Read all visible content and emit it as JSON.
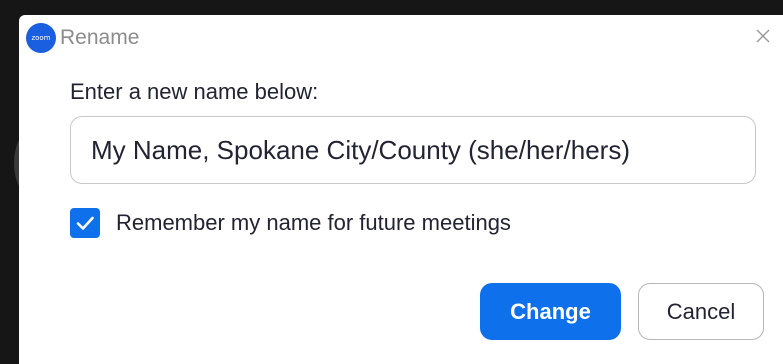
{
  "window": {
    "app_icon_text": "zoom",
    "title": "Rename",
    "close_icon": "close-icon"
  },
  "form": {
    "prompt": "Enter a new name below:",
    "name_value": "My Name, Spokane City/County (she/her/hers)",
    "remember_checked": true,
    "remember_label": "Remember my name for future meetings"
  },
  "buttons": {
    "change_label": "Change",
    "cancel_label": "Cancel"
  },
  "colors": {
    "accent": "#0e71eb",
    "app_icon": "#1a5fe0",
    "background": "#161616"
  }
}
